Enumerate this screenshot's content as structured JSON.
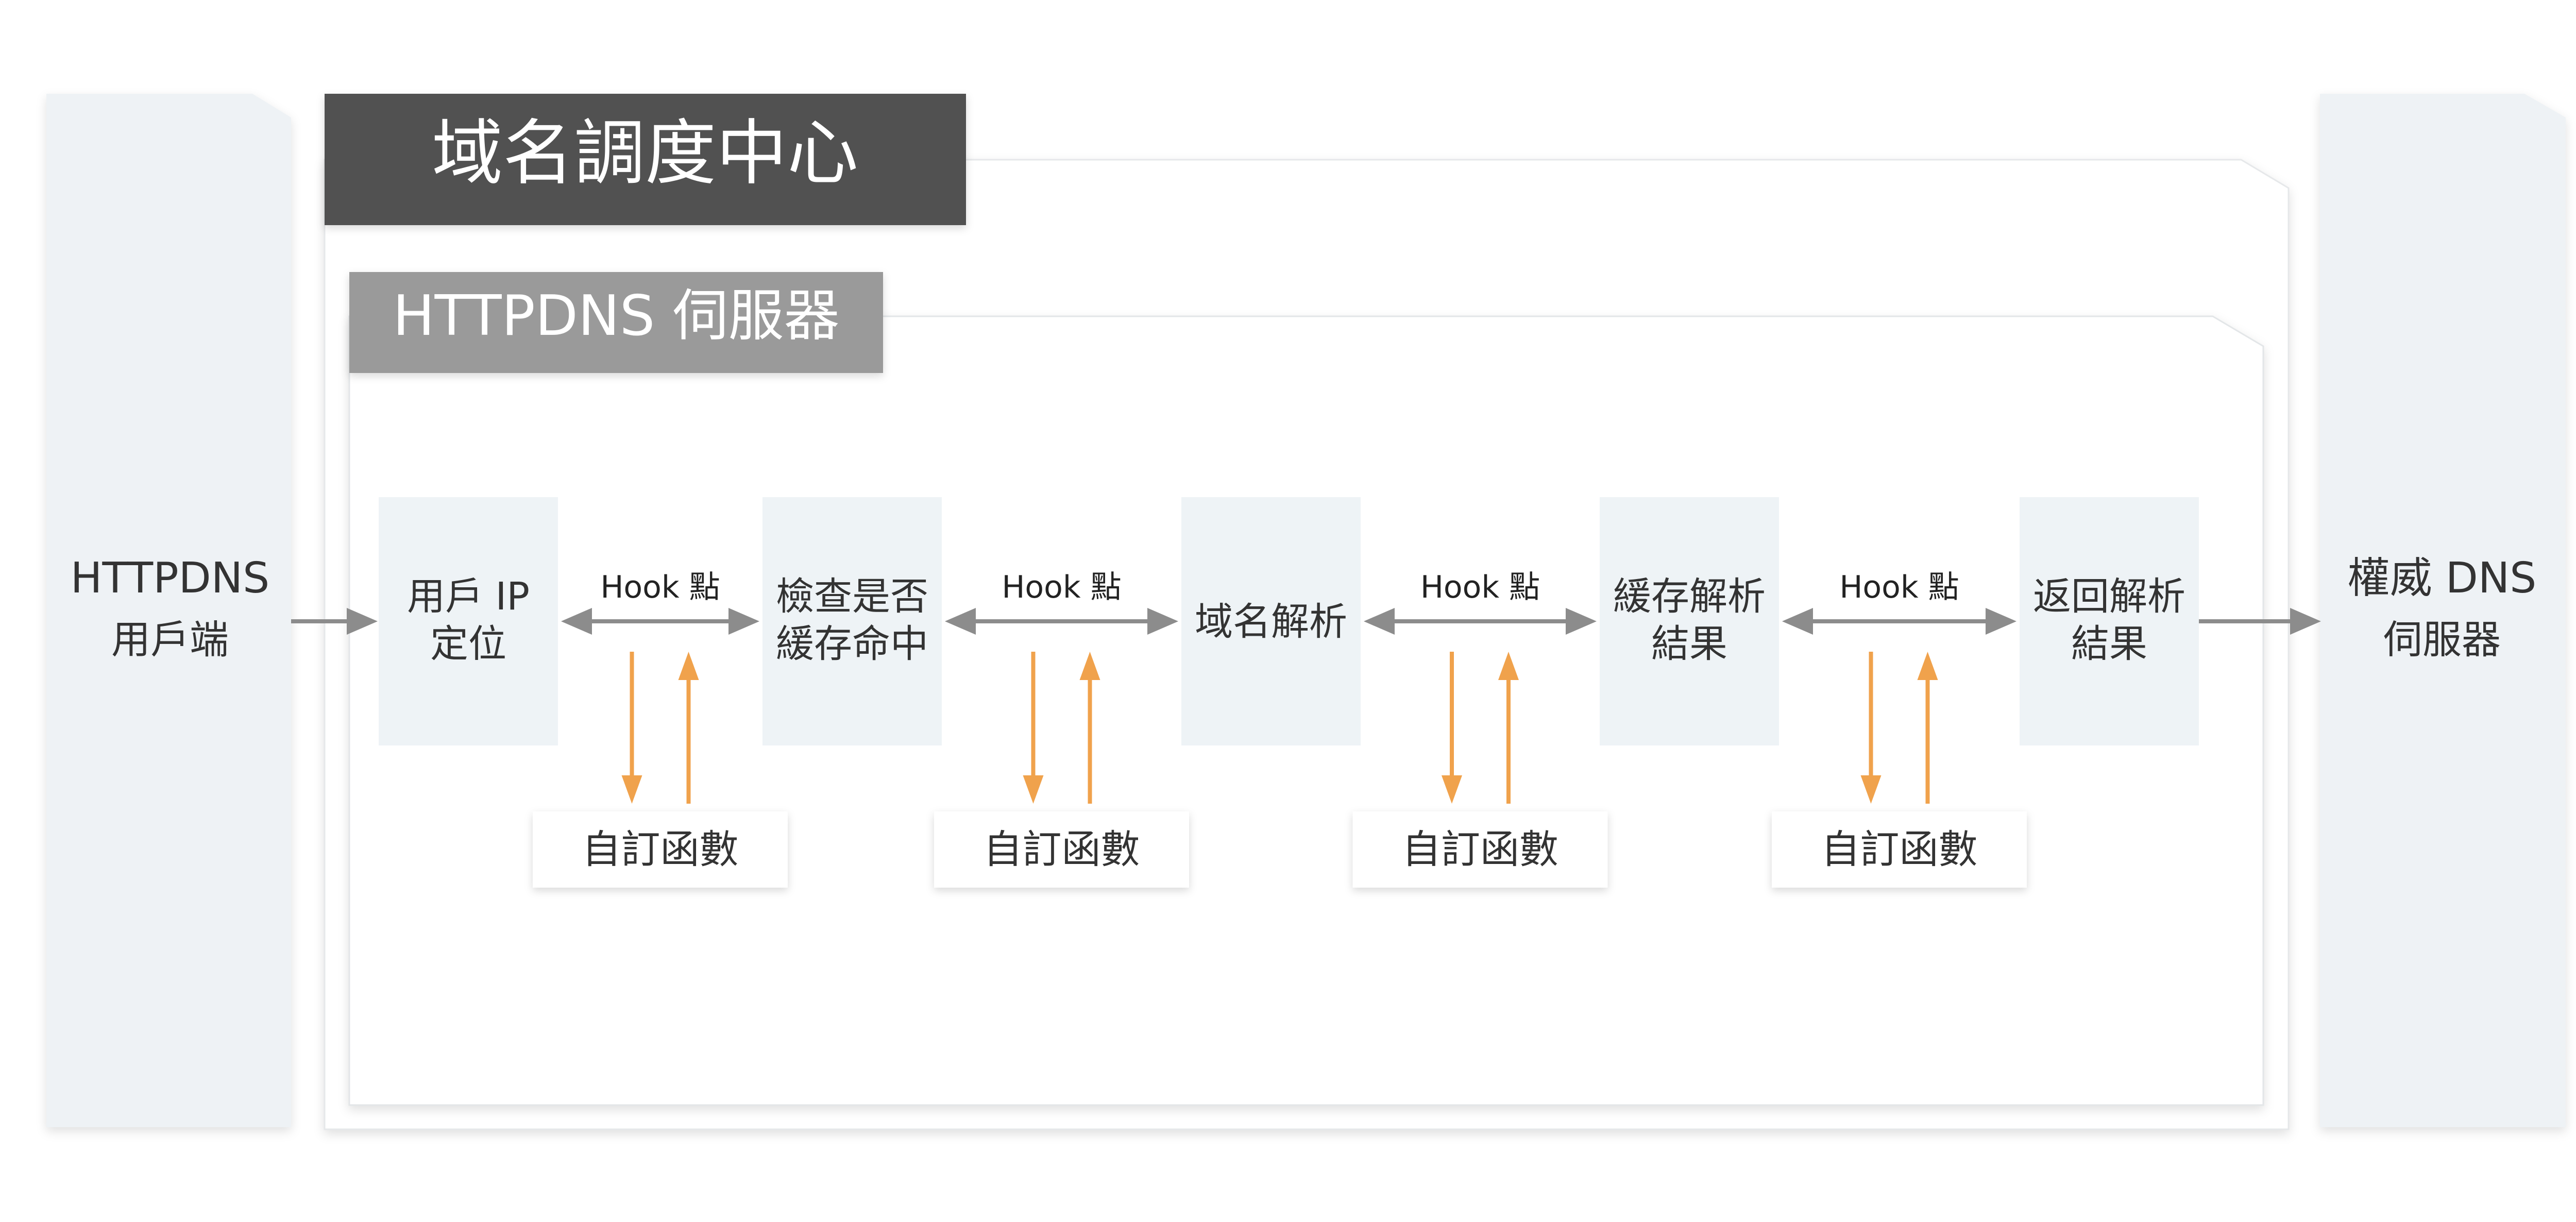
{
  "center": {
    "title": "域名調度中心",
    "server_title": "HTTPDNS 伺服器"
  },
  "client": {
    "line1": "HTTPDNS",
    "line2": "用戶端"
  },
  "authority": {
    "line1": "權威 DNS",
    "line2": "伺服器"
  },
  "steps": [
    {
      "line1": "用戶 IP",
      "line2": "定位"
    },
    {
      "line1": "檢查是否",
      "line2": "緩存命中"
    },
    {
      "line1": "域名解析",
      "line2": ""
    },
    {
      "line1": "緩存解析",
      "line2": "結果"
    },
    {
      "line1": "返回解析",
      "line2": "結果"
    }
  ],
  "hooks": [
    {
      "label": "Hook 點",
      "function_label": "自訂函數"
    },
    {
      "label": "Hook 點",
      "function_label": "自訂函數"
    },
    {
      "label": "Hook 點",
      "function_label": "自訂函數"
    },
    {
      "label": "Hook 點",
      "function_label": "自訂函數"
    }
  ],
  "colors": {
    "side_column": "#eef2f5",
    "step_box": "#eef3f6",
    "title_dark": "#515151",
    "title_gray": "#9a9a9a",
    "flow_arrow": "#8c8c8c",
    "hook_arrow": "#f0a24c",
    "text": "#333333"
  }
}
